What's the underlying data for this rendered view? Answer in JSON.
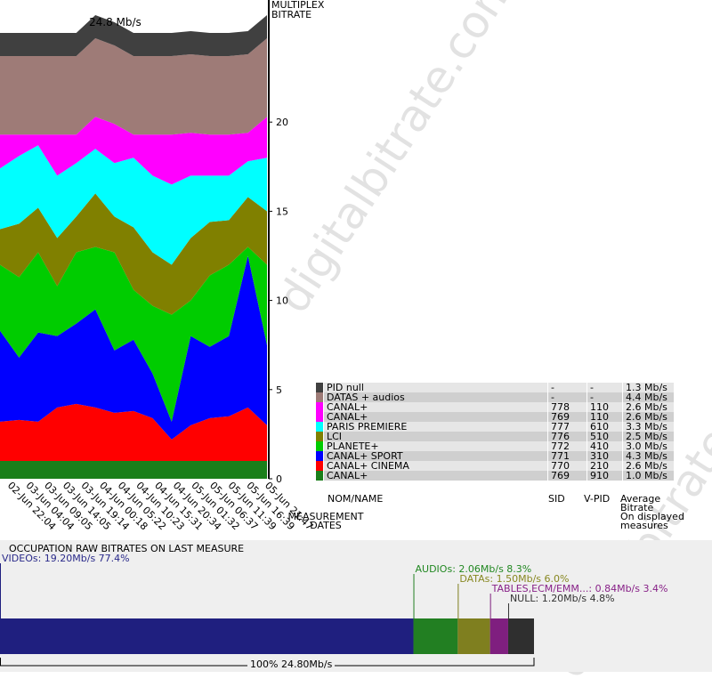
{
  "watermark": "digitalbitrate.com",
  "chart_data": {
    "type": "area",
    "title": "MULTIPLEX BITRATE",
    "total_label": "24.8 Mb/s",
    "xlabel": "MEASUREMENT DATES",
    "ylabel": "",
    "ylim": [
      0,
      25
    ],
    "yticks": [
      "0",
      "5",
      "10",
      "15",
      "20"
    ],
    "x": [
      "02-Jun 22:04",
      "03-Jun 04:04",
      "03-Jun 09:05",
      "03-Jun 14:05",
      "03-Jun 19:14",
      "04-Jun 00:18",
      "04-Jun 05:22",
      "04-Jun 10:23",
      "04-Jun 15:31",
      "04-Jun 20:34",
      "05-Jun 01:32",
      "05-Jun 06:37",
      "05-Jun 11:39",
      "05-Jun 16:39",
      "05-Jun 21:47"
    ],
    "series": [
      {
        "name": "CANAL+",
        "color": "#1a7f1a",
        "values": [
          1.0,
          1.0,
          1.0,
          1.0,
          1.0,
          1.0,
          1.0,
          1.0,
          1.0,
          1.0,
          1.0,
          1.0,
          1.0,
          1.0,
          1.0
        ]
      },
      {
        "name": "CANAL+ CINEMA",
        "color": "#ff0000",
        "values": [
          2.2,
          2.3,
          2.2,
          3.0,
          3.2,
          3.0,
          2.7,
          2.8,
          2.4,
          1.2,
          2.0,
          2.4,
          2.5,
          3.0,
          2.0
        ]
      },
      {
        "name": "CANAL+ SPORT",
        "color": "#0000ff",
        "values": [
          5.1,
          3.5,
          5.0,
          4.0,
          4.5,
          5.5,
          3.5,
          4.0,
          2.5,
          1.0,
          5.0,
          4.0,
          4.5,
          8.5,
          4.5
        ]
      },
      {
        "name": "PLANETE+",
        "color": "#00cc00",
        "values": [
          3.7,
          4.5,
          4.5,
          2.8,
          4.0,
          3.5,
          5.5,
          2.8,
          3.8,
          6.0,
          2.0,
          4.0,
          4.0,
          0.5,
          4.5
        ]
      },
      {
        "name": "LCI",
        "color": "#808000",
        "values": [
          2.0,
          3.0,
          2.5,
          2.7,
          2.0,
          3.0,
          2.0,
          3.5,
          3.0,
          2.8,
          3.5,
          3.0,
          2.5,
          2.8,
          3.0
        ]
      },
      {
        "name": "PARIS PREMIERE",
        "color": "#00ffff",
        "values": [
          3.4,
          3.8,
          3.5,
          3.5,
          3.0,
          2.5,
          3.0,
          3.9,
          4.3,
          4.5,
          3.5,
          2.6,
          2.5,
          2.0,
          3.0
        ]
      },
      {
        "name": "CANAL+",
        "color": "#ff00ff",
        "values": [
          1.9,
          1.2,
          0.6,
          2.3,
          1.6,
          1.8,
          2.2,
          1.3,
          2.3,
          2.8,
          2.4,
          2.3,
          2.3,
          1.6,
          2.3
        ]
      },
      {
        "name": "DATAS + audios",
        "color": "#9e7b77",
        "values": [
          4.4,
          4.4,
          4.4,
          4.4,
          4.4,
          4.4,
          4.4,
          4.4,
          4.4,
          4.4,
          4.4,
          4.4,
          4.4,
          4.4,
          4.4
        ]
      },
      {
        "name": "PID null",
        "color": "#404040",
        "values": [
          1.3,
          1.3,
          1.3,
          1.3,
          1.3,
          1.3,
          1.3,
          1.3,
          1.3,
          1.3,
          1.3,
          1.3,
          1.3,
          1.3,
          1.3
        ]
      }
    ]
  },
  "legend": {
    "rows": [
      {
        "name": "PID null",
        "sid": "-",
        "vpid": "-",
        "avg": "1.3 Mb/s",
        "color": "#404040"
      },
      {
        "name": "DATAS + audios",
        "sid": "-",
        "vpid": "-",
        "avg": "4.4 Mb/s",
        "color": "#9e7b77"
      },
      {
        "name": "CANAL+",
        "sid": "778",
        "vpid": "110",
        "avg": "2.6 Mb/s",
        "color": "#ff00ff"
      },
      {
        "name": "CANAL+",
        "sid": "769",
        "vpid": "110",
        "avg": "2.6 Mb/s",
        "color": "#ff00ff"
      },
      {
        "name": "PARIS PREMIERE",
        "sid": "777",
        "vpid": "610",
        "avg": "3.3 Mb/s",
        "color": "#00ffff"
      },
      {
        "name": "LCI",
        "sid": "776",
        "vpid": "510",
        "avg": "2.5 Mb/s",
        "color": "#808000"
      },
      {
        "name": "PLANETE+",
        "sid": "772",
        "vpid": "410",
        "avg": "3.0 Mb/s",
        "color": "#00cc00"
      },
      {
        "name": "CANAL+ SPORT",
        "sid": "771",
        "vpid": "310",
        "avg": "4.3 Mb/s",
        "color": "#0000ff"
      },
      {
        "name": "CANAL+ CINEMA",
        "sid": "770",
        "vpid": "210",
        "avg": "2.6 Mb/s",
        "color": "#ff0000"
      },
      {
        "name": "CANAL+",
        "sid": "769",
        "vpid": "910",
        "avg": "1.0 Mb/s",
        "color": "#1a7f1a"
      }
    ],
    "headers": {
      "name": "NOM/NAME",
      "sid": "SID",
      "vpid": "V-PID",
      "avg_line1": "Average",
      "avg_line2": "Bitrate",
      "avg_line3": "On displayed",
      "avg_line4": "measures"
    }
  },
  "occupation": {
    "title": "OCCUPATION RAW BITRATES ON LAST MEASURE",
    "total_label": "100%  24.80Mb/s",
    "segments": [
      {
        "label": "VIDEOs: 19.20Mb/s  77.4%",
        "value": 19.2,
        "percent": 77.4,
        "color": "#1f1f7f",
        "text_color": "#2a2a8a"
      },
      {
        "label": "AUDIOs: 2.06Mb/s  8.3%",
        "value": 2.06,
        "percent": 8.3,
        "color": "#227f22",
        "text_color": "#228822"
      },
      {
        "label": "DATAs: 1.50Mb/s  6.0%",
        "value": 1.5,
        "percent": 6.0,
        "color": "#7f7f1f",
        "text_color": "#888822"
      },
      {
        "label": "TABLES,ECM/EMM...: 0.84Mb/s  3.4%",
        "value": 0.84,
        "percent": 3.4,
        "color": "#7f1f7f",
        "text_color": "#882288"
      },
      {
        "label": "NULL: 1.20Mb/s  4.8%",
        "value": 1.2,
        "percent": 4.8,
        "color": "#2f2f2f",
        "text_color": "#333333"
      }
    ]
  }
}
